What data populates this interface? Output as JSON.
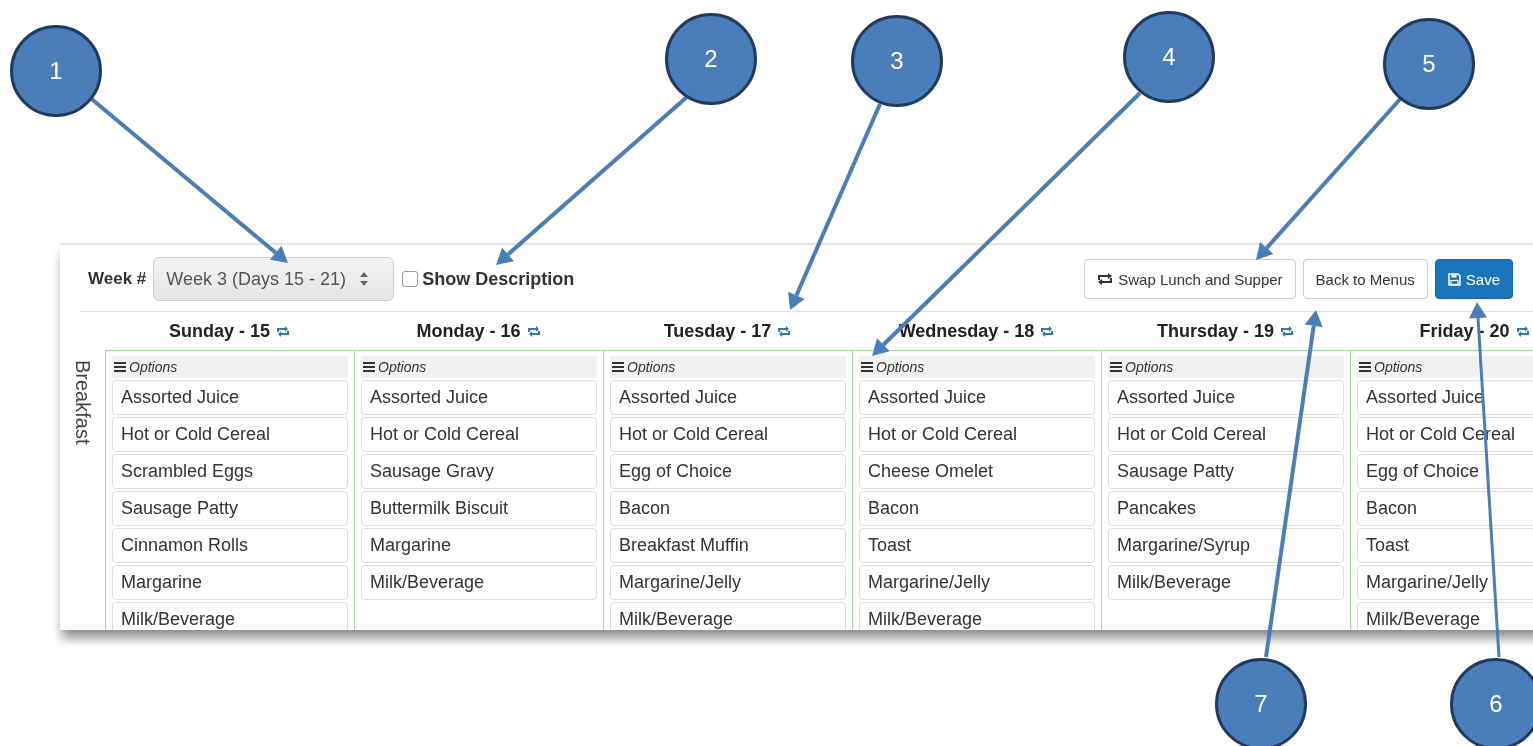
{
  "toolbar": {
    "week_label": "Week #",
    "week_select": {
      "value": "Week 3 (Days 15 - 21)"
    },
    "show_description": {
      "label": "Show Description",
      "checked": false
    },
    "buttons": [
      {
        "label": "Swap Lunch and Supper",
        "kind": "swap"
      },
      {
        "label": "Back to Menus",
        "kind": "default"
      },
      {
        "label": "Save",
        "kind": "primary"
      }
    ]
  },
  "meal": "Breakfast",
  "days": [
    {
      "title": "Sunday - 15",
      "options": "Options",
      "items": [
        "Assorted Juice",
        "Hot or Cold Cereal",
        "Scrambled Eggs",
        "Sausage Patty",
        "Cinnamon Rolls",
        "Margarine",
        "Milk/Beverage"
      ]
    },
    {
      "title": "Monday - 16",
      "options": "Options",
      "items": [
        "Assorted Juice",
        "Hot or Cold Cereal",
        "Sausage Gravy",
        "Buttermilk Biscuit",
        "Margarine",
        "Milk/Beverage"
      ]
    },
    {
      "title": "Tuesday - 17",
      "options": "Options",
      "items": [
        "Assorted Juice",
        "Hot or Cold Cereal",
        "Egg of Choice",
        "Bacon",
        "Breakfast Muffin",
        "Margarine/Jelly",
        "Milk/Beverage"
      ]
    },
    {
      "title": "Wednesday - 18",
      "options": "Options",
      "items": [
        "Assorted Juice",
        "Hot or Cold Cereal",
        "Cheese Omelet",
        "Bacon",
        "Toast",
        "Margarine/Jelly",
        "Milk/Beverage"
      ]
    },
    {
      "title": "Thursday - 19",
      "options": "Options",
      "items": [
        "Assorted Juice",
        "Hot or Cold Cereal",
        "Sausage Patty",
        "Pancakes",
        "Margarine/Syrup",
        "Milk/Beverage"
      ]
    },
    {
      "title": "Friday - 20",
      "options": "Options",
      "items": [
        "Assorted Juice",
        "Hot or Cold Cereal",
        "Egg of Choice",
        "Bacon",
        "Toast",
        "Margarine/Jelly",
        "Milk/Beverage"
      ]
    }
  ],
  "callouts": [
    {
      "number": "1"
    },
    {
      "number": "2"
    },
    {
      "number": "3"
    },
    {
      "number": "4"
    },
    {
      "number": "5"
    },
    {
      "number": "7"
    },
    {
      "number": "6"
    }
  ]
}
